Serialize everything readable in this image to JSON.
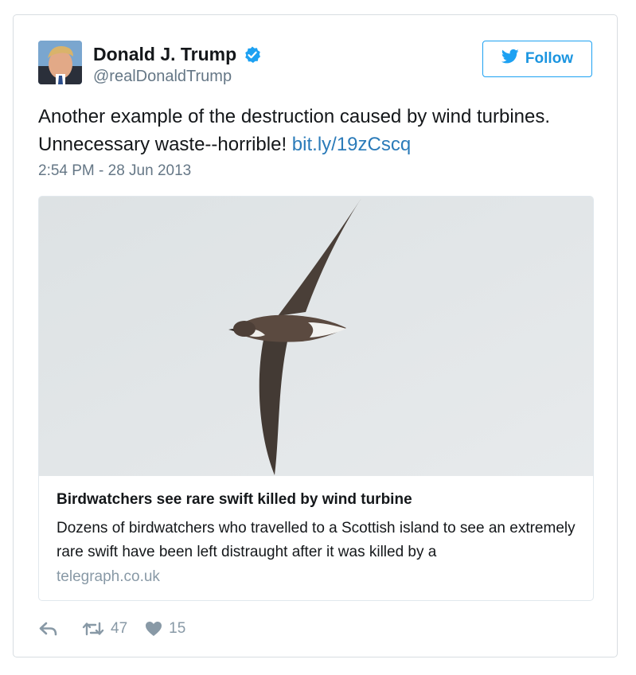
{
  "author": {
    "display_name": "Donald J. Trump",
    "handle": "@realDonaldTrump",
    "verified_icon": "verified-badge-icon"
  },
  "follow_button": {
    "label": "Follow",
    "icon": "twitter-bird-icon"
  },
  "tweet": {
    "text": "Another example of the destruction caused by wind turbines. Unnecessary waste--horrible!",
    "link": "bit.ly/19zCscq",
    "timestamp": "2:54 PM - 28 Jun 2013"
  },
  "card": {
    "title": "Birdwatchers see rare swift killed by wind turbine",
    "description": "Dozens of birdwatchers who travelled to a Scottish island to see an extremely rare swift have been left distraught after it was killed by a",
    "domain": "telegraph.co.uk"
  },
  "actions": {
    "reply_icon": "reply-icon",
    "retweet_icon": "retweet-icon",
    "retweet_count": "47",
    "like_icon": "heart-icon",
    "like_count": "15"
  },
  "colors": {
    "link": "#2b7bb9",
    "accent": "#1da1f2",
    "muted": "#657786",
    "card_border": "#e1e8ed"
  }
}
